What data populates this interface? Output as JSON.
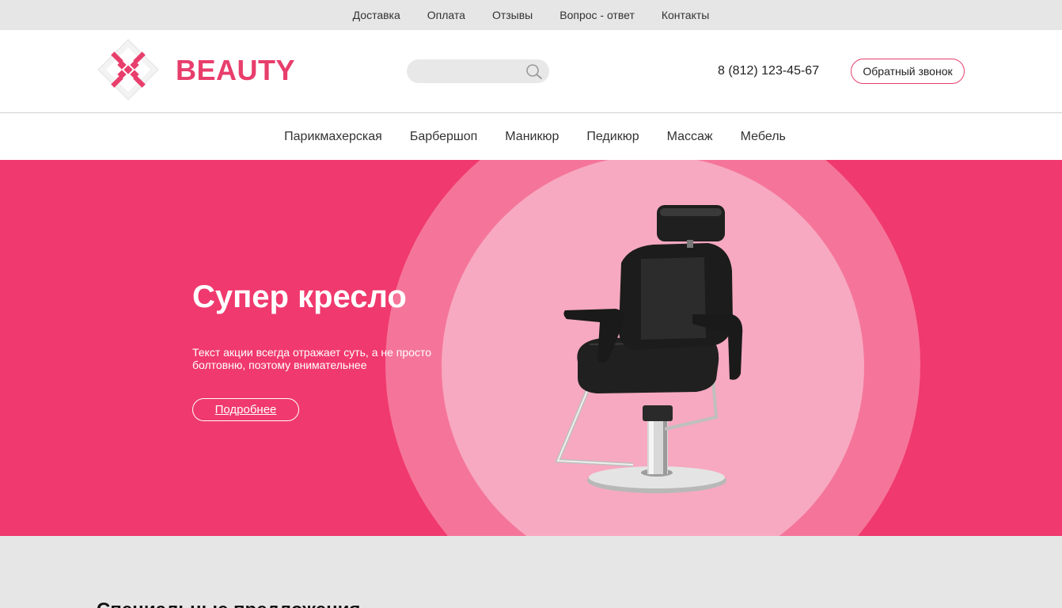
{
  "top_menu": {
    "items": [
      "Доставка",
      "Оплата",
      "Отзывы",
      "Вопрос - ответ",
      "Контакты"
    ]
  },
  "header": {
    "logo_text": "BEAUTY",
    "search": {
      "placeholder": "",
      "value": ""
    },
    "phone": "8 (812) 123-45-67",
    "callback_label": "Обратный звонок"
  },
  "category_nav": {
    "items": [
      "Парикмахерская",
      "Барбершоп",
      "Маникюр",
      "Педикюр",
      "Массаж",
      "Мебель"
    ]
  },
  "hero": {
    "title": "Супер кресло",
    "text": "Текст акции всегда отражает суть, а не просто болтовню, поэтому внимательнее",
    "button_label": "Подробнее",
    "image": "barber-chair-image"
  },
  "special": {
    "title": "Специальные предложения"
  },
  "colors": {
    "accent": "#e83e6c",
    "hero_bg": "#f0396e",
    "circle_outer": "#f5759a",
    "circle_inner": "#f7a9c1",
    "topbar_bg": "#e6e6e6"
  },
  "icons": {
    "search": "search-icon",
    "logo": "logo-icon"
  }
}
